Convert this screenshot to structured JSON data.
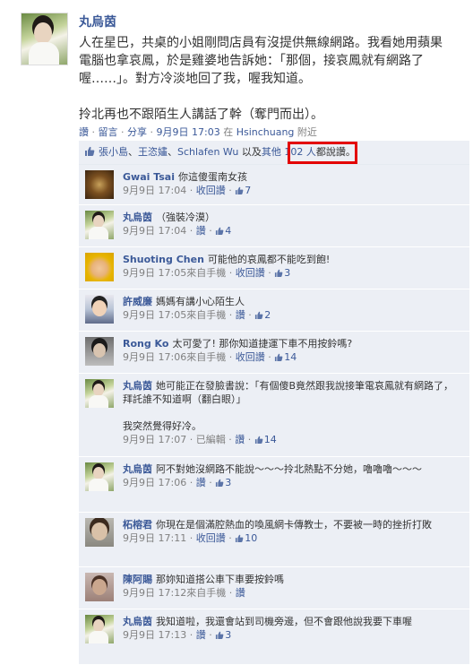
{
  "post": {
    "author": "丸烏茵",
    "text_lines": [
      "人在星巴，共桌的小姐剛問店員有沒提供無線網路。我看她用蘋果",
      "電腦也拿哀鳳，於是雞婆地告訴她：「那個，接哀鳳就有網路了",
      "喔……」。對方冷淡地回了我，喔我知道。",
      "",
      "拎北再也不跟陌生人講話了幹（奪門而出）。"
    ],
    "meta": {
      "read": "讚",
      "comment": "留言",
      "share": "分享",
      "timestamp": "9月9日 17:03",
      "location_prefix": "在",
      "location": "Hsinchuang",
      "nearby": "附近"
    }
  },
  "likes": {
    "names": [
      "張小島",
      "王恣嫿",
      "Schlafen Wu"
    ],
    "separator": "、",
    "connector": "以及",
    "others": "其他 102 人",
    "suffix": "都說讚。"
  },
  "comments": [
    {
      "name": "Gwai Tsai",
      "text": "你這傻蛋南女孩",
      "time": "9月9日 17:04",
      "via": "",
      "edited": "",
      "action": "收回讚",
      "likes": "7",
      "avatar": "av-gwai"
    },
    {
      "name": "丸烏茵",
      "text": "（強裝冷漠）",
      "time": "9月9日 17:04",
      "via": "",
      "edited": "",
      "action": "讚",
      "likes": "4",
      "avatar": "av-yan"
    },
    {
      "name": "Shuoting Chen",
      "text": "可能他的哀鳳都不能吃到飽!",
      "time": "9月9日 17:05",
      "via": "來自手機",
      "edited": "",
      "action": "收回讚",
      "likes": "3",
      "avatar": "av-shuoting"
    },
    {
      "name": "許威廉",
      "text": "媽媽有講小心陌生人",
      "time": "9月9日 17:05",
      "via": "來自手機",
      "edited": "",
      "action": "讚",
      "likes": "2",
      "avatar": "av-xu"
    },
    {
      "name": "Rong Ko",
      "text": "太可愛了! 那你知道捷運下車不用按鈴嗎?",
      "time": "9月9日 17:06",
      "via": "來自手機",
      "edited": "",
      "action": "收回讚",
      "likes": "14",
      "avatar": "av-rong"
    },
    {
      "name": "丸烏茵",
      "text": "她可能正在發臉書說：「有個傻B竟然跟我說接筆電哀鳳就有網路了，拜託誰不知道啊（翻白眼）」",
      "text2": "我突然覺得好冷。",
      "time": "9月9日 17:07",
      "via": "",
      "edited": "已編輯",
      "action": "讚",
      "likes": "14",
      "avatar": "av-yan"
    },
    {
      "name": "丸烏茵",
      "text": "阿不對她沒網路不能說～～～拎北熱點不分她，嚕嚕嚕～～～",
      "time": "9月9日 17:06",
      "via": "",
      "edited": "",
      "action": "讚",
      "likes": "3",
      "avatar": "av-yan"
    },
    {
      "name": "柘榕君",
      "text": "你現在是個滿腔熱血的喚風網卡傳教士，不要被一時的挫折打敗",
      "time": "9月9日 17:11",
      "via": "",
      "edited": "",
      "action": "收回讚",
      "likes": "10",
      "avatar": "av-zhe"
    },
    {
      "name": "陳阿賜",
      "text": "那妳知道搭公車下車要按鈴嗎",
      "time": "9月9日 17:12",
      "via": "來自手機",
      "edited": "",
      "action": "讚",
      "likes": "",
      "avatar": "av-chen"
    },
    {
      "name": "丸烏茵",
      "text": "我知道啦，我還會站到司機旁邊，但不會跟他說我要下車喔",
      "time": "9月9日 17:13",
      "via": "",
      "edited": "",
      "action": "讚",
      "likes": "3",
      "avatar": "av-yan"
    }
  ],
  "colors": {
    "link": "#3b5998",
    "comment_bg": "#eceff5",
    "highlight": "#e30000"
  },
  "icons": {
    "like": "thumbs-up-icon"
  }
}
